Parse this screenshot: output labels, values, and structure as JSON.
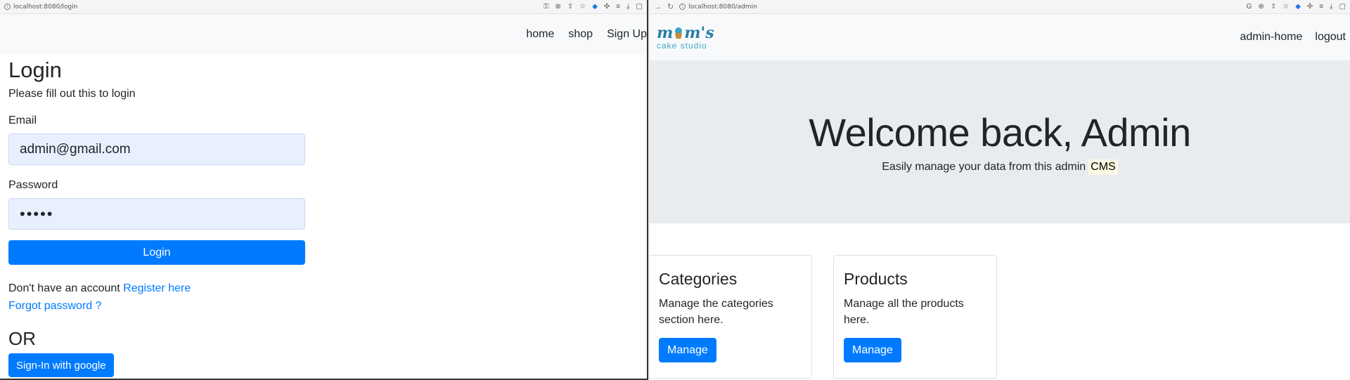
{
  "left_window": {
    "url": "localhost:8080/login",
    "nav": {
      "items": [
        "home",
        "shop",
        "Sign Up"
      ]
    },
    "login": {
      "title": "Login",
      "subtitle": "Please fill out this to login",
      "email_label": "Email",
      "email_value": "admin@gmail.com",
      "password_label": "Password",
      "password_value": "•••••",
      "login_button": "Login",
      "register_prefix": "Don't have an account",
      "register_link": "Register here",
      "forgot_link": "Forgot password ?",
      "or_text": "OR",
      "google_button": "Sign-In with google"
    }
  },
  "right_window": {
    "url": "localhost:8080/admin",
    "logo": {
      "main": "mom's",
      "sub": "cake studio"
    },
    "nav": {
      "admin_home": "admin-home",
      "logout": "logout"
    },
    "hero": {
      "title": "Welcome back, Admin",
      "subtitle": "Easily manage your data from this admin",
      "highlight": "CMS"
    },
    "cards": [
      {
        "title": "Categories",
        "text": "Manage the categories section here.",
        "button": "Manage"
      },
      {
        "title": "Products",
        "text": "Manage all the products here.",
        "button": "Manage"
      }
    ]
  },
  "colors": {
    "primary": "#007bff",
    "jumbotron_bg": "#e9ecef",
    "navbar_bg": "#f8f9fa",
    "autofill_bg": "#e8f0fe",
    "highlight_bg": "#fcf8e3"
  }
}
